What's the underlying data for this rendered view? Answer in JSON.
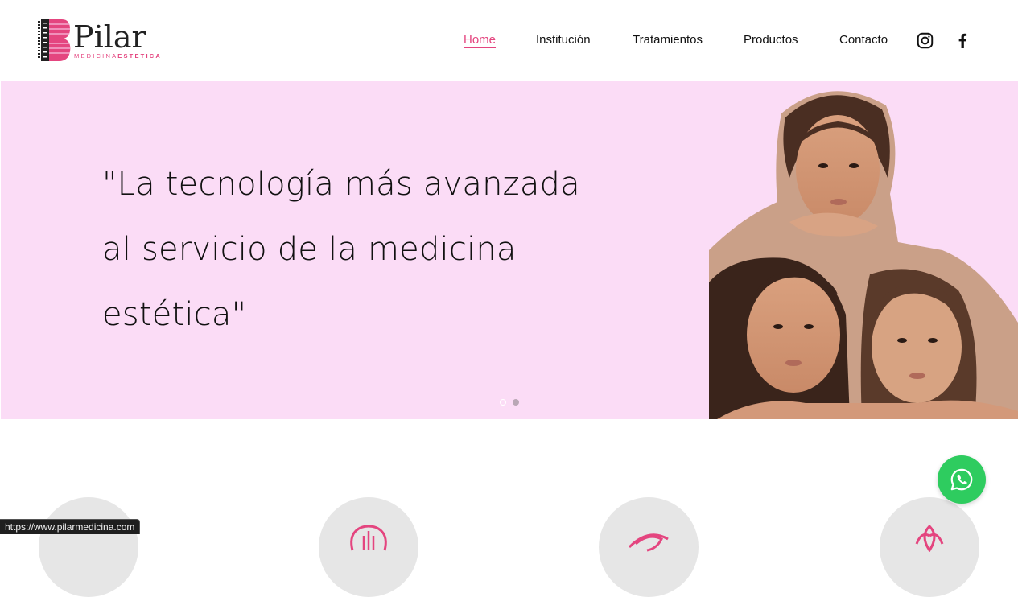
{
  "brand": {
    "name": "Pilar",
    "subtitle_light": "MEDICINA",
    "subtitle_bold": "ESTETICA",
    "accent_color": "#e4457f"
  },
  "nav": {
    "items": [
      {
        "label": "Home",
        "active": true
      },
      {
        "label": "Institución",
        "active": false
      },
      {
        "label": "Tratamientos",
        "active": false
      },
      {
        "label": "Productos",
        "active": false
      },
      {
        "label": "Contacto",
        "active": false
      }
    ],
    "social": [
      "instagram-icon",
      "facebook-icon"
    ]
  },
  "hero": {
    "background_color": "#fbdcf6",
    "quote_lines": [
      "\"La tecnología más avanzada",
      "al servicio de la medicina",
      "estética\""
    ],
    "slides": {
      "count": 2,
      "active_index": 0
    }
  },
  "features": {
    "icons": [
      "feature-icon-1",
      "brain-icon",
      "eye-icon",
      "lotus-icon"
    ]
  },
  "whatsapp": {
    "icon": "whatsapp-icon",
    "color": "#2ecc5f"
  },
  "status_bar": {
    "url": "https://www.pilarmedicina.com"
  }
}
